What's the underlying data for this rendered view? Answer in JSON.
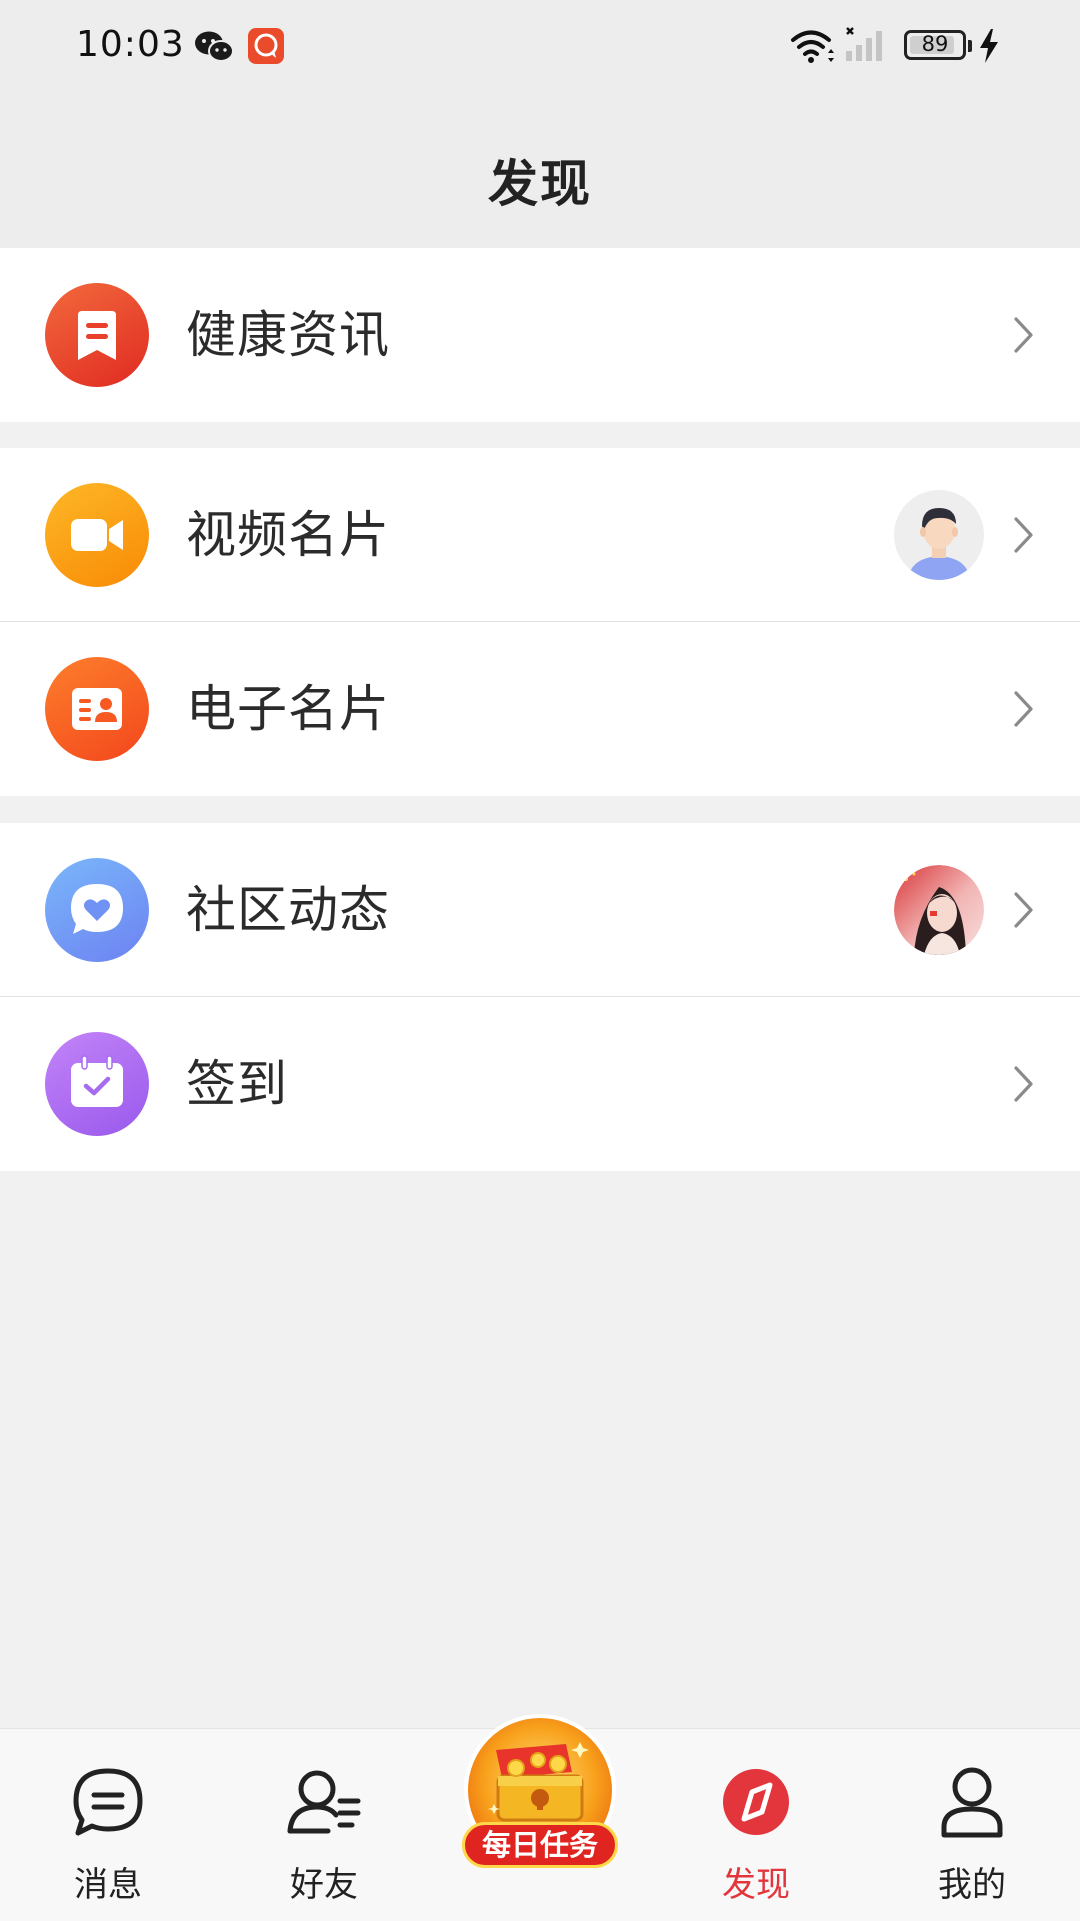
{
  "status_bar": {
    "time": "10:03",
    "battery": "89",
    "battery_level": 0.89
  },
  "header": {
    "title": "发现"
  },
  "menu": {
    "items": [
      {
        "label": "健康资讯",
        "icon": "bookmark-icon",
        "color": "#ea3a2c"
      },
      {
        "label": "视频名片",
        "icon": "video-camera-icon",
        "color": "#fb9a0a"
      },
      {
        "label": "电子名片",
        "icon": "id-card-icon",
        "color": "#fa5a22"
      },
      {
        "label": "社区动态",
        "icon": "heart-chat-icon",
        "color": "#6a95f5"
      },
      {
        "label": "签到",
        "icon": "calendar-check-icon",
        "color": "#a56bf0"
      }
    ]
  },
  "tab_bar": {
    "tabs": [
      {
        "label": "消息",
        "icon": "message-icon"
      },
      {
        "label": "好友",
        "icon": "friends-icon"
      },
      {
        "label": "发现",
        "icon": "compass-icon",
        "active": true
      },
      {
        "label": "我的",
        "icon": "person-icon"
      }
    ],
    "daily_task": "每日任务",
    "active_color": "#e2363c"
  }
}
